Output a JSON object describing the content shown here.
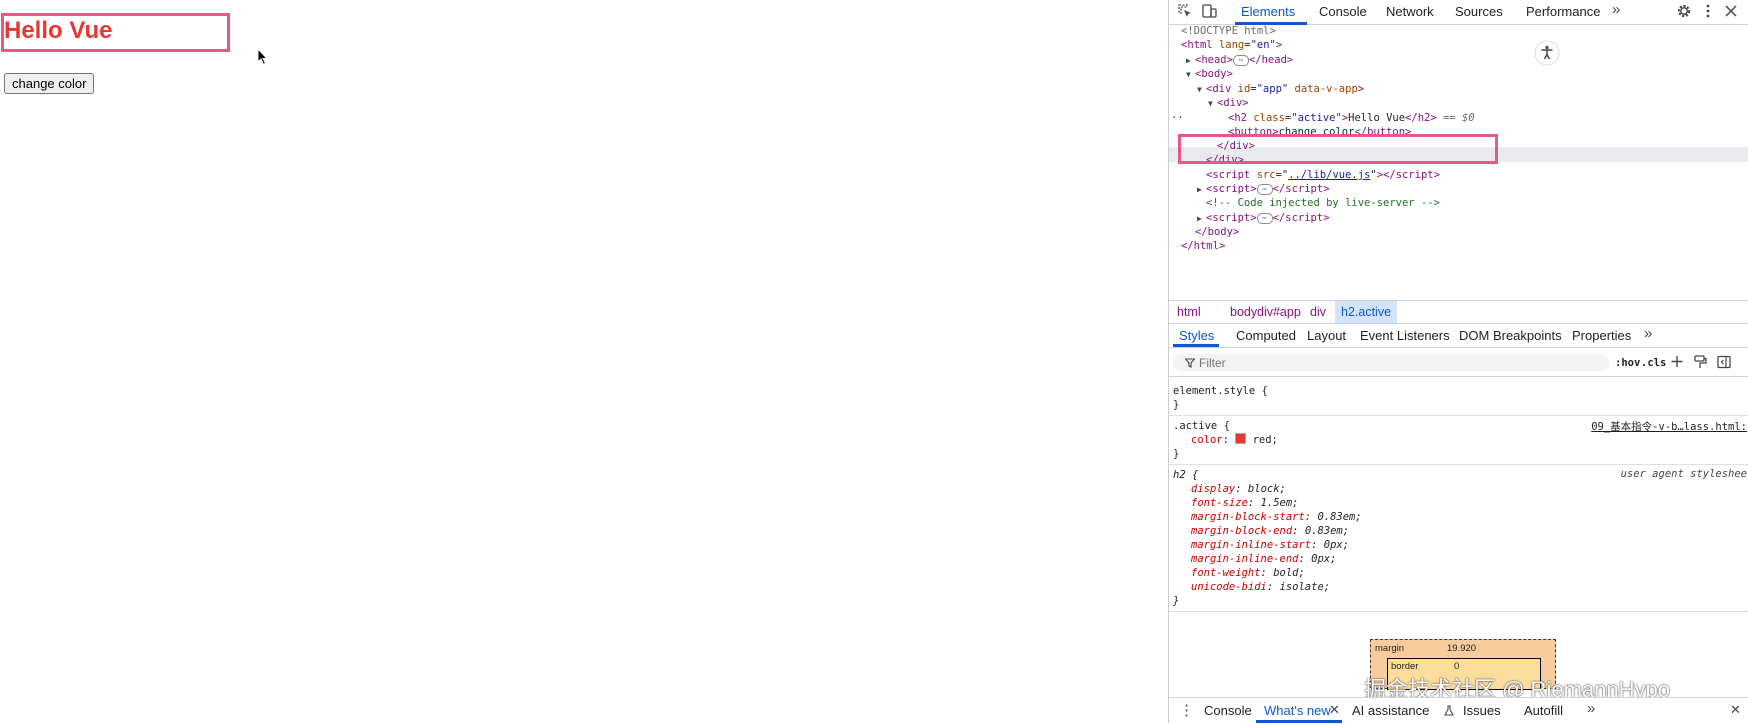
{
  "page": {
    "heading": "Hello Vue",
    "button_label": "change color",
    "heading_color": "#e53935",
    "highlight_color": "#e9578a"
  },
  "devtools": {
    "tabs": [
      "Elements",
      "Console",
      "Network",
      "Sources",
      "Performance"
    ],
    "more_tabs": "»",
    "dom": {
      "doctype": "<!DOCTYPE html>",
      "html_open_tag": "html",
      "html_lang_attr": "lang",
      "html_lang_val": "\"en\"",
      "head_tag": "head",
      "body_tag": "body",
      "div_app_tag": "div",
      "div_app_id_attr": "id",
      "div_app_id_val": "\"app\"",
      "div_app_extra_attr": "data-v-app",
      "div_inner_tag": "div",
      "h2_tag": "h2",
      "h2_class_attr": "class",
      "h2_class_val": "\"active\"",
      "h2_text": "Hello Vue",
      "h2_selected_marker": "== $0",
      "button_tag": "button",
      "button_text": "change color",
      "script_tag": "script",
      "script_src_attr": "src",
      "script_src_val": "../lib/vue.js",
      "comment": "<!-- Code injected by live-server -->",
      "ellipsis": "⋯"
    },
    "breadcrumbs": [
      "html",
      "body",
      "div#app",
      "div",
      "h2.active"
    ],
    "subtabs": [
      "Styles",
      "Computed",
      "Layout",
      "Event Listeners",
      "DOM Breakpoints",
      "Properties"
    ],
    "filter": {
      "placeholder": "Filter",
      "hov": ":hov",
      "cls": ".cls"
    },
    "styles": {
      "element_style": "element.style {",
      "close_brace": "}",
      "active_selector": ".active {",
      "active_source": "09_基本指令-v-b…lass.html:",
      "color_prop": "color",
      "color_val": "red;",
      "h2_selector": "h2 {",
      "h2_source": "user agent styleshee",
      "h2_props": [
        {
          "name": "display",
          "value": "block;"
        },
        {
          "name": "font-size",
          "value": "1.5em;"
        },
        {
          "name": "margin-block-start",
          "value": "0.83em;"
        },
        {
          "name": "margin-block-end",
          "value": "0.83em;"
        },
        {
          "name": "margin-inline-start",
          "value": "0px;"
        },
        {
          "name": "margin-inline-end",
          "value": "0px;"
        },
        {
          "name": "font-weight",
          "value": "bold;"
        },
        {
          "name": "unicode-bidi",
          "value": "isolate;"
        }
      ]
    },
    "box_model": {
      "margin_label": "margin",
      "margin_value": "19.920",
      "border_label": "border",
      "border_value": "0"
    },
    "watermark": "掘金技术社区 @ RiemannHypo",
    "drawer_tabs": [
      "Console",
      "What's new",
      "AI assistance",
      "Issues",
      "Autofill"
    ]
  }
}
